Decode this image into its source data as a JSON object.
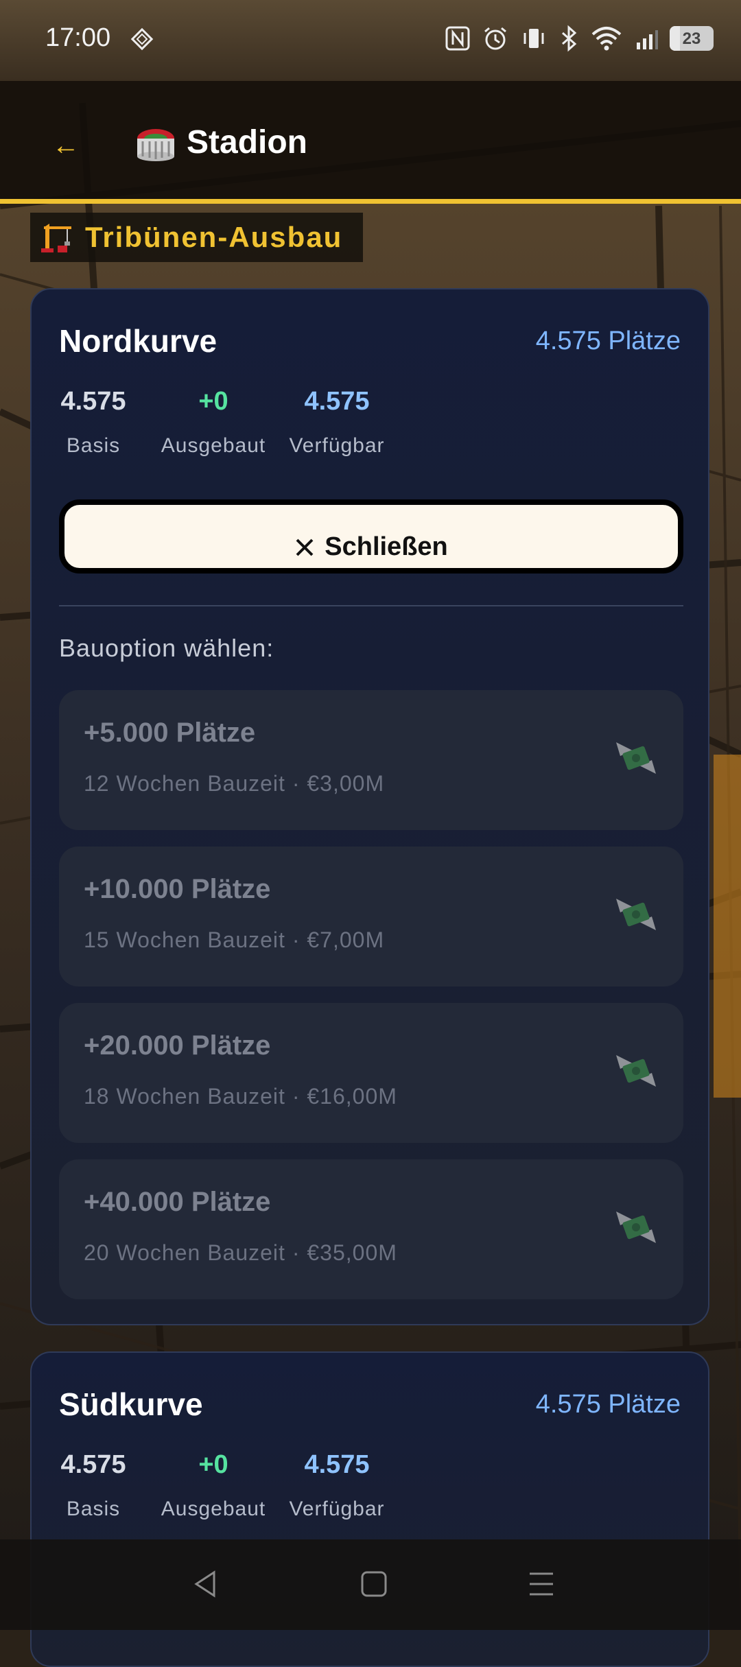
{
  "status_bar": {
    "time": "17:00",
    "battery": "23",
    "icons": [
      "nfc-icon",
      "alarm-icon",
      "vibrate-icon",
      "bluetooth-icon",
      "wifi-icon",
      "signal-icon",
      "battery-icon"
    ]
  },
  "header": {
    "back_label": "←",
    "title": "Stadion",
    "icon": "stadium-icon",
    "accent_color": "#f0c232"
  },
  "section": {
    "icon": "crane-icon",
    "title": "Tribünen-Ausbau"
  },
  "stands": [
    {
      "name": "Nordkurve",
      "seats": "4.575 Plätze",
      "stats": [
        {
          "value": "4.575",
          "label": "Basis"
        },
        {
          "value": "+0",
          "label": "Ausgebaut"
        },
        {
          "value": "4.575",
          "label": "Verfügbar"
        }
      ],
      "close_label": "Schließen",
      "choose_label": "Bauoption wählen:",
      "options": [
        {
          "title": "+5.000 Plätze",
          "subtitle": "12 Wochen Bauzeit · €3,00M"
        },
        {
          "title": "+10.000 Plätze",
          "subtitle": "15 Wochen Bauzeit · €7,00M"
        },
        {
          "title": "+20.000 Plätze",
          "subtitle": "18 Wochen Bauzeit · €16,00M"
        },
        {
          "title": "+40.000 Plätze",
          "subtitle": "20 Wochen Bauzeit · €35,00M"
        }
      ]
    },
    {
      "name": "Südkurve",
      "seats": "4.575 Plätze",
      "stats": [
        {
          "value": "4.575",
          "label": "Basis"
        },
        {
          "value": "+0",
          "label": "Ausgebaut"
        },
        {
          "value": "4.575",
          "label": "Verfügbar"
        }
      ]
    }
  ],
  "colors": {
    "accent": "#f0c232",
    "seats_blue": "#7fb6ff",
    "gain_green": "#56e3a0",
    "card_bg": "#151d38"
  }
}
